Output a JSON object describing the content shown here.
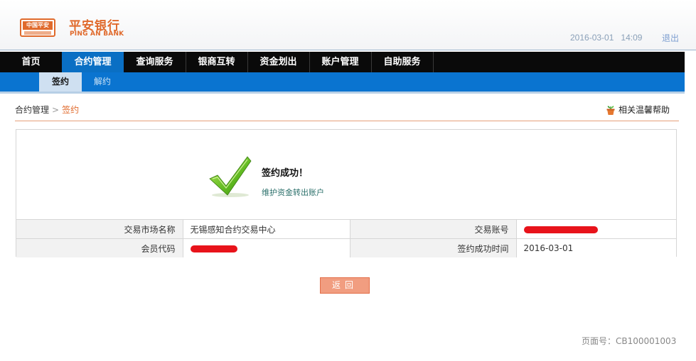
{
  "header": {
    "logo_badge_text": "中国平安",
    "bank_name_cn": "平安银行",
    "bank_name_en": "PING AN BANK",
    "date": "2016-03-01",
    "time": "14:09",
    "logout_label": "退出"
  },
  "main_nav": {
    "items": [
      {
        "label": "首页"
      },
      {
        "label": "合约管理"
      },
      {
        "label": "查询服务"
      },
      {
        "label": "银商互转"
      },
      {
        "label": "资金划出"
      },
      {
        "label": "账户管理"
      },
      {
        "label": "自助服务"
      }
    ],
    "active_index": 1
  },
  "sub_nav": {
    "items": [
      {
        "label": "签约"
      },
      {
        "label": "解约"
      }
    ],
    "active_index": 0
  },
  "breadcrumb": {
    "parent": "合约管理",
    "separator": ">",
    "current": "签约"
  },
  "help_label": "相关温馨帮助",
  "result": {
    "title": "签约成功！",
    "link": "维护资金转出账户"
  },
  "info_table": {
    "rows": [
      {
        "label1": "交易市场名称",
        "value1": "无锡感知合约交易中心",
        "label2": "交易账号",
        "value2": ""
      },
      {
        "label1": "会员代码",
        "value1": "",
        "label2": "签约成功时间",
        "value2": "2016-03-01"
      }
    ]
  },
  "back_button_label": "返回",
  "page_number": "页面号：CB100001003",
  "colors": {
    "brand_orange": "#e06a2c",
    "nav_active_blue": "#0a6fc4",
    "redaction_red": "#e8131b"
  }
}
